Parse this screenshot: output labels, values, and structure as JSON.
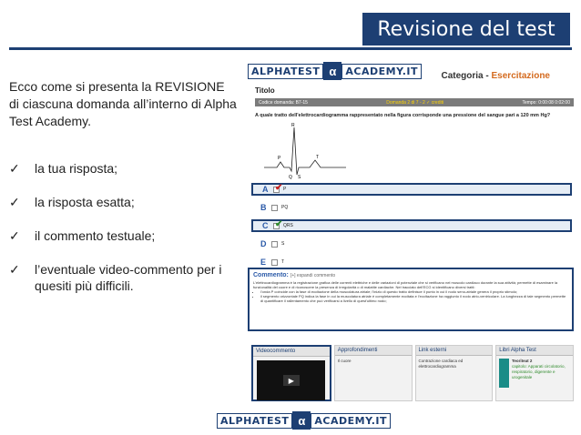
{
  "header": {
    "title": "Revisione del test"
  },
  "intro": {
    "text": "Ecco come si presenta la REVISIONE di ciascuna domanda all’interno di Alpha Test Academy."
  },
  "bullets": [
    {
      "icon": "checkmark-icon",
      "text": "la tua risposta;"
    },
    {
      "icon": "checkmark-icon",
      "text": "la risposta esatta;"
    },
    {
      "icon": "checkmark-icon",
      "text": "il commento testuale;"
    },
    {
      "icon": "checkmark-icon",
      "text": "l’eventuale video-commento per i quesiti più difficili."
    }
  ],
  "logo": {
    "part1": "ALPHATEST",
    "part2": "α",
    "part3": "ACADEMY.IT"
  },
  "screenshot": {
    "category_label": "Categoria - ",
    "category_value": "Esercitazione",
    "titolo": "Titolo",
    "infobar": {
      "code": "Codice domanda: B7-15",
      "progress": "Domanda 2 di 7 - 2 ✓ crediti",
      "time": "Tempo: 0:00:08 0:02:00"
    },
    "question": "A quale tratto dell'elettrocardiogramma rappresentato nella figura corrisponde una pressione del sangue pari a 120 mm Hg?",
    "ecg_labels": {
      "r": "R",
      "p": "P",
      "t": "T",
      "q": "Q",
      "s": "S"
    },
    "answers": [
      {
        "letter": "A",
        "text": "P",
        "selected": true,
        "mark": "✔",
        "mark_color": "#c8201e"
      },
      {
        "letter": "B",
        "text": "PQ",
        "selected": false,
        "mark": "",
        "mark_color": ""
      },
      {
        "letter": "C",
        "text": "QRS",
        "selected": true,
        "mark": "✔",
        "mark_color": "#2f8a2b"
      },
      {
        "letter": "D",
        "text": "S",
        "selected": false,
        "mark": "",
        "mark_color": ""
      },
      {
        "letter": "E",
        "text": "T",
        "selected": false,
        "mark": "",
        "mark_color": ""
      }
    ],
    "comment": {
      "heading": "Commento:",
      "expand": "[+] espandi commento",
      "body": "L'elettrocardiogramma è la registrazione grafica delle correnti elettriche e delle variazioni di potenziale che si verificano nel muscolo cardiaco durante la sua attività; permette di esaminare la funzionalità del cuore e di riconoscere la presenza di irregolarità o di malattie cardiache. Nel tracciato dell'ECG si identificano diversi tratti:",
      "items": [
        "l'onda P coincide con la fase di eccitazione della muscolatura atriale; l'inizio di questo tratto definisce il punto in cui il nodo seno-atriale genera il proprio stimolo;",
        "il segmento orizzontale PQ indica la fase in cui la muscolatura atriale è completamente eccitata e l'eccitazione ha raggiunto il nodo atrio-ventricolare. La lunghezza di tale segmento permette di quantificare il rallentamento che può verificarsi a livello di quest'ultimo nodo;"
      ]
    },
    "bottom": {
      "video_header": "Videocommento",
      "play_icon": "play-icon",
      "approfondimenti_header": "Approfondimenti",
      "approfondimenti_text": "Il cuore",
      "link_header": "Link esterni",
      "link_text": "Contrazione cardiaca ed elettrocardiogramma",
      "libri_header": "Libri Alpha Test",
      "libri_text_title": "Teoriteat 2",
      "libri_text": "capitolo: Apparati circolatorio, respiratorio, digerente e urogenitale"
    }
  },
  "colors": {
    "brand": "#1d3f73",
    "accent_orange": "#d46a1e",
    "wrong_red": "#c8201e",
    "right_green": "#2f8a2b"
  }
}
